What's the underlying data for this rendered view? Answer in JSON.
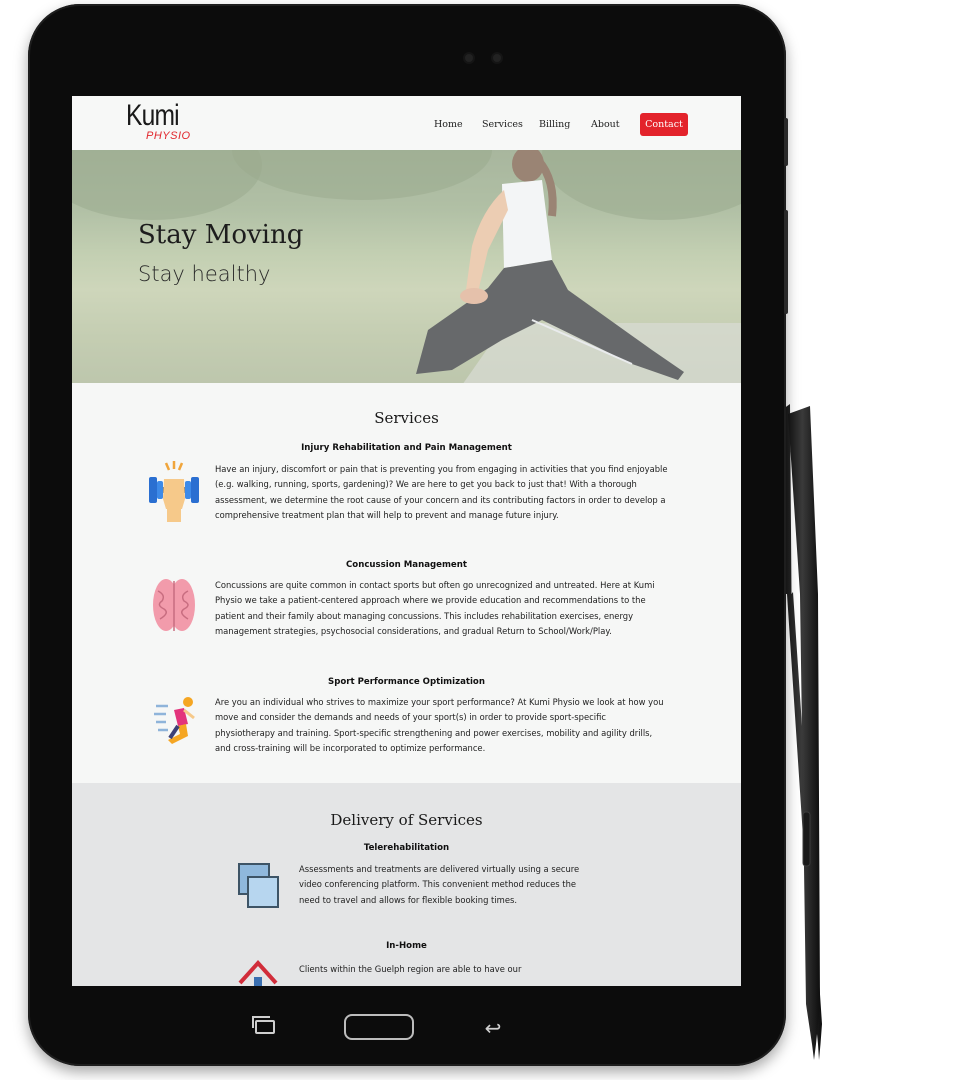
{
  "brand": {
    "name": "Kumi",
    "sub": "PHYSIO"
  },
  "nav": {
    "home": "Home",
    "services": "Services",
    "billing": "Billing",
    "about": "About",
    "contact": "Contact"
  },
  "hero": {
    "title": "Stay Moving",
    "subtitle": "Stay healthy"
  },
  "services": {
    "title": "Services",
    "items": [
      {
        "title": "Injury Rehabilitation and Pain Management",
        "icon": "dumbbell-fist-icon",
        "lines": [
          "Have an injury, discomfort or pain that is preventing you from engaging in activities that you find enjoyable",
          "(e.g. walking, running, sports, gardening)? We are here to get you back to just that! With a thorough",
          "assessment, we determine the root cause of your concern and its contributing factors in order to develop a",
          "comprehensive treatment plan that will help to prevent and manage future injury."
        ]
      },
      {
        "title": "Concussion Management",
        "icon": "brain-icon",
        "lines": [
          "Concussions are quite common in contact sports but often go unrecognized and untreated. Here at Kumi",
          "Physio we take a patient-centered approach where we provide education and recommendations to the",
          "patient and their family about managing concussions. This includes rehabilitation exercises, energy",
          "management strategies, psychosocial considerations, and gradual Return to School/Work/Play."
        ]
      },
      {
        "title": "Sport Performance Optimization",
        "icon": "runner-icon",
        "lines": [
          "Are you an individual who strives to maximize your sport performance? At Kumi Physio we look at how you",
          "move and consider the demands and needs of your sport(s) in order to provide sport-specific",
          "physiotherapy and training. Sport-specific strengthening and power exercises, mobility and agility drills,",
          "and cross-training will be incorporated to optimize performance."
        ]
      }
    ]
  },
  "delivery": {
    "title": "Delivery of Services",
    "items": [
      {
        "title": "Telerehabilitation",
        "icon": "video-windows-icon",
        "lines": [
          "Assessments and treatments are delivered virtually using a secure",
          "video conferencing platform. This convenient method reduces the",
          "need to travel and allows for flexible booking times."
        ]
      },
      {
        "title": "In-Home",
        "icon": "house-icon",
        "lines": [
          "Clients within the Guelph region are able to have our"
        ]
      }
    ]
  }
}
